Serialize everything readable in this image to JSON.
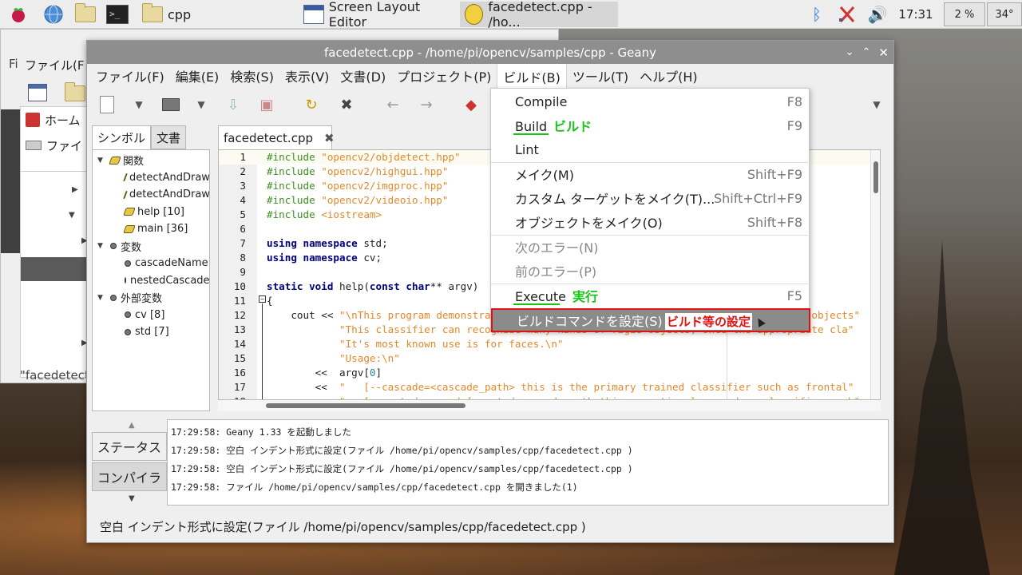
{
  "taskbar": {
    "tasks": [
      {
        "label": "cpp"
      },
      {
        "label": "Screen Layout Editor"
      },
      {
        "label": "facedetect.cpp - /ho..."
      }
    ],
    "clock": "17:31",
    "cpu": "2 %",
    "temp": "34°"
  },
  "file_manager": {
    "menu_label": "ファイル(F",
    "side_items": [
      "ホーム",
      "ファイ"
    ],
    "status": "\"facedetect."
  },
  "geany": {
    "title": "facedetect.cpp - /home/pi/opencv/samples/cpp - Geany",
    "menus": [
      "ファイル(F)",
      "編集(E)",
      "検索(S)",
      "表示(V)",
      "文書(D)",
      "プロジェクト(P)",
      "ビルド(B)",
      "ツール(T)",
      "ヘルプ(H)"
    ],
    "sidebar_tabs": [
      "シンボル",
      "文書"
    ],
    "tree": [
      {
        "type": "group",
        "label": "関数",
        "icon": "function"
      },
      {
        "type": "leaf",
        "label": "detectAndDraw",
        "icon": "function"
      },
      {
        "type": "leaf",
        "label": "detectAndDraw",
        "icon": "function"
      },
      {
        "type": "leaf",
        "label": "help [10]",
        "icon": "function"
      },
      {
        "type": "leaf",
        "label": "main [36]",
        "icon": "function"
      },
      {
        "type": "group",
        "label": "変数",
        "icon": "variable"
      },
      {
        "type": "leaf",
        "label": "cascadeName",
        "icon": "variable"
      },
      {
        "type": "leaf",
        "label": "nestedCascade",
        "icon": "variable"
      },
      {
        "type": "group",
        "label": "外部変数",
        "icon": "variable"
      },
      {
        "type": "leaf",
        "label": "cv [8]",
        "icon": "variable"
      },
      {
        "type": "leaf",
        "label": "std [7]",
        "icon": "variable"
      }
    ],
    "editor_tab": "facedetect.cpp",
    "code_lines": [
      {
        "n": "1",
        "html": "<span class=\"pp\">#include </span><span class=\"str\">\"opencv2/objdetect.hpp\"</span>"
      },
      {
        "n": "2",
        "html": "<span class=\"pp\">#include </span><span class=\"str\">\"opencv2/highgui.hpp\"</span>"
      },
      {
        "n": "3",
        "html": "<span class=\"pp\">#include </span><span class=\"str\">\"opencv2/imgproc.hpp\"</span>"
      },
      {
        "n": "4",
        "html": "<span class=\"pp\">#include </span><span class=\"str\">\"opencv2/videoio.hpp\"</span>"
      },
      {
        "n": "5",
        "html": "<span class=\"pp\">#include </span><span class=\"str\">&lt;iostream&gt;</span>"
      },
      {
        "n": "6",
        "html": ""
      },
      {
        "n": "7",
        "html": "<span class=\"kw\">using namespace</span> std;"
      },
      {
        "n": "8",
        "html": "<span class=\"kw\">using namespace</span> cv;"
      },
      {
        "n": "9",
        "html": ""
      },
      {
        "n": "10",
        "html": "<span class=\"kw\">static void</span> help(<span class=\"kw\">const char</span>** argv)"
      },
      {
        "n": "11",
        "html": "{"
      },
      {
        "n": "12",
        "html": "    cout &lt;&lt; <span class=\"str\">\"\\nThis program demonstrates the use of cv::CascadeClassifier class to detect objects\"</span>"
      },
      {
        "n": "13",
        "html": "            <span class=\"str\">\"This classifier can recognize many kinds of rigid objects, once the appropriate cla\"</span>"
      },
      {
        "n": "14",
        "html": "            <span class=\"str\">\"It's most known use is for faces.\\n\"</span>"
      },
      {
        "n": "15",
        "html": "            <span class=\"str\">\"Usage:\\n\"</span>"
      },
      {
        "n": "16",
        "html": "        &lt;&lt;  argv[<span class=\"num\">0</span>]"
      },
      {
        "n": "17",
        "html": "        &lt;&lt;  <span class=\"str\">\"   [--cascade=&lt;cascade_path&gt; this is the primary trained classifier such as frontal\"</span>"
      },
      {
        "n": "18",
        "html": "            <span class=\"str\">\"   [--nested-cascade[=nested_cascade_path this an optional secondary classifier such\"</span>"
      }
    ],
    "msg_tabs": [
      "ステータス",
      "コンパイラ"
    ],
    "messages": [
      "17:29:58: Geany 1.33 を起動しました",
      "17:29:58: 空白 インデント形式に設定(ファイル /home/pi/opencv/samples/cpp/facedetect.cpp )",
      "17:29:58: 空白 インデント形式に設定(ファイル /home/pi/opencv/samples/cpp/facedetect.cpp )",
      "17:29:58: ファイル /home/pi/opencv/samples/cpp/facedetect.cpp を開きました(1)"
    ],
    "status": "空白 インデント形式に設定(ファイル /home/pi/opencv/samples/cpp/facedetect.cpp )"
  },
  "build_menu": {
    "items": [
      {
        "label": "Compile",
        "accel": "F8",
        "disabled": false
      },
      {
        "label": "Build",
        "accel": "F9",
        "disabled": false,
        "annotation": "ビルド"
      },
      {
        "label": "Lint",
        "accel": "",
        "disabled": false
      },
      {
        "label": "メイク(M)",
        "accel": "Shift+F9",
        "disabled": false
      },
      {
        "label": "カスタム ターゲットをメイク(T)...",
        "accel": "Shift+Ctrl+F9",
        "disabled": false
      },
      {
        "label": "オブジェクトをメイク(O)",
        "accel": "Shift+F8",
        "disabled": false
      },
      {
        "label": "次のエラー(N)",
        "accel": "",
        "disabled": true
      },
      {
        "label": "前のエラー(P)",
        "accel": "",
        "disabled": true
      },
      {
        "label": "Execute",
        "accel": "F5",
        "disabled": false,
        "annotation": "実行"
      },
      {
        "label": "ビルドコマンドを設定(S)",
        "accel": "",
        "disabled": false,
        "annotation": "ビルド等の設定"
      }
    ]
  },
  "colors": {
    "accent_green": "#18c418",
    "highlight_red": "#e01010",
    "menu_highlight": "#8b8b8b"
  }
}
